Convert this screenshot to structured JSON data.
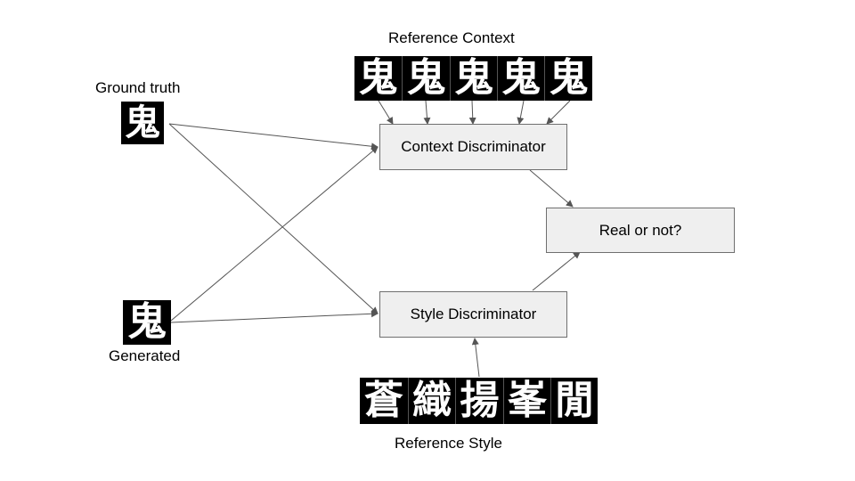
{
  "labels": {
    "reference_context": "Reference Context",
    "ground_truth": "Ground truth",
    "generated": "Generated",
    "reference_style": "Reference Style"
  },
  "boxes": {
    "context_discriminator": "Context Discriminator",
    "style_discriminator": "Style Discriminator",
    "real_or_not": "Real or not?"
  },
  "glyphs": {
    "ground_truth": "鬼",
    "generated": "鬼",
    "reference_context": [
      "鬼",
      "鬼",
      "鬼",
      "鬼",
      "鬼"
    ],
    "reference_style": [
      "蒼",
      "織",
      "揚",
      "峯",
      "閒"
    ]
  },
  "colors": {
    "box_fill": "#efefef",
    "box_border": "#6f6f6f",
    "arrow": "#555555",
    "tile_background": "#000000",
    "glyph": "#ffffff"
  }
}
